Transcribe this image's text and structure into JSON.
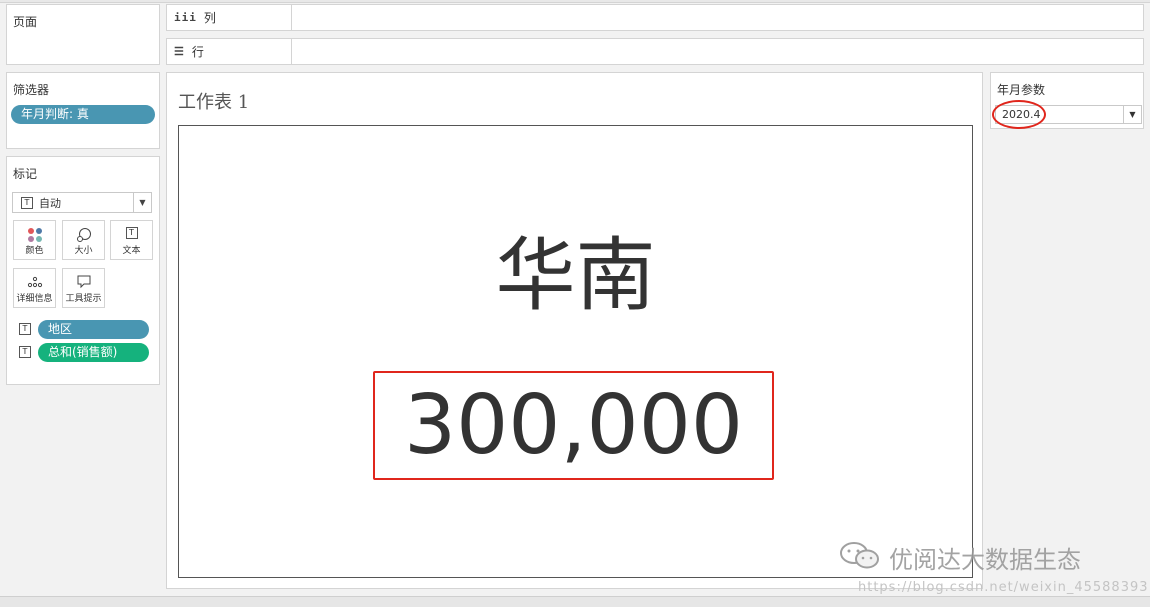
{
  "cards": {
    "pages": "页面",
    "filters": "筛选器",
    "marks": "标记"
  },
  "shelves": {
    "columns": "列",
    "rows": "行"
  },
  "filters": [
    "年月判断: 真"
  ],
  "marks": {
    "type": "自动",
    "buttons": [
      "颜色",
      "大小",
      "文本",
      "详细信息",
      "工具提示"
    ],
    "fields": [
      {
        "label": "地区",
        "color": "#4996b2"
      },
      {
        "label": "总和(销售额)",
        "color": "#15b27d"
      }
    ]
  },
  "worksheet": {
    "title": "工作表 1",
    "region": "华南",
    "sales": "300,000"
  },
  "parameter": {
    "title": "年月参数",
    "value": "2020.4"
  },
  "watermark": {
    "text": "优阅达大数据生态",
    "url": "https://blog.csdn.net/weixin_45588393"
  },
  "colors": {
    "highlight": "#e0261c",
    "pill_blue": "#4996b2",
    "pill_green": "#15b27d"
  },
  "icons": [
    "columns-icon",
    "rows-icon",
    "text-mark-icon",
    "color-icon",
    "size-icon",
    "detail-icon",
    "tooltip-icon",
    "dropdown-arrow-icon",
    "wechat-icon"
  ]
}
